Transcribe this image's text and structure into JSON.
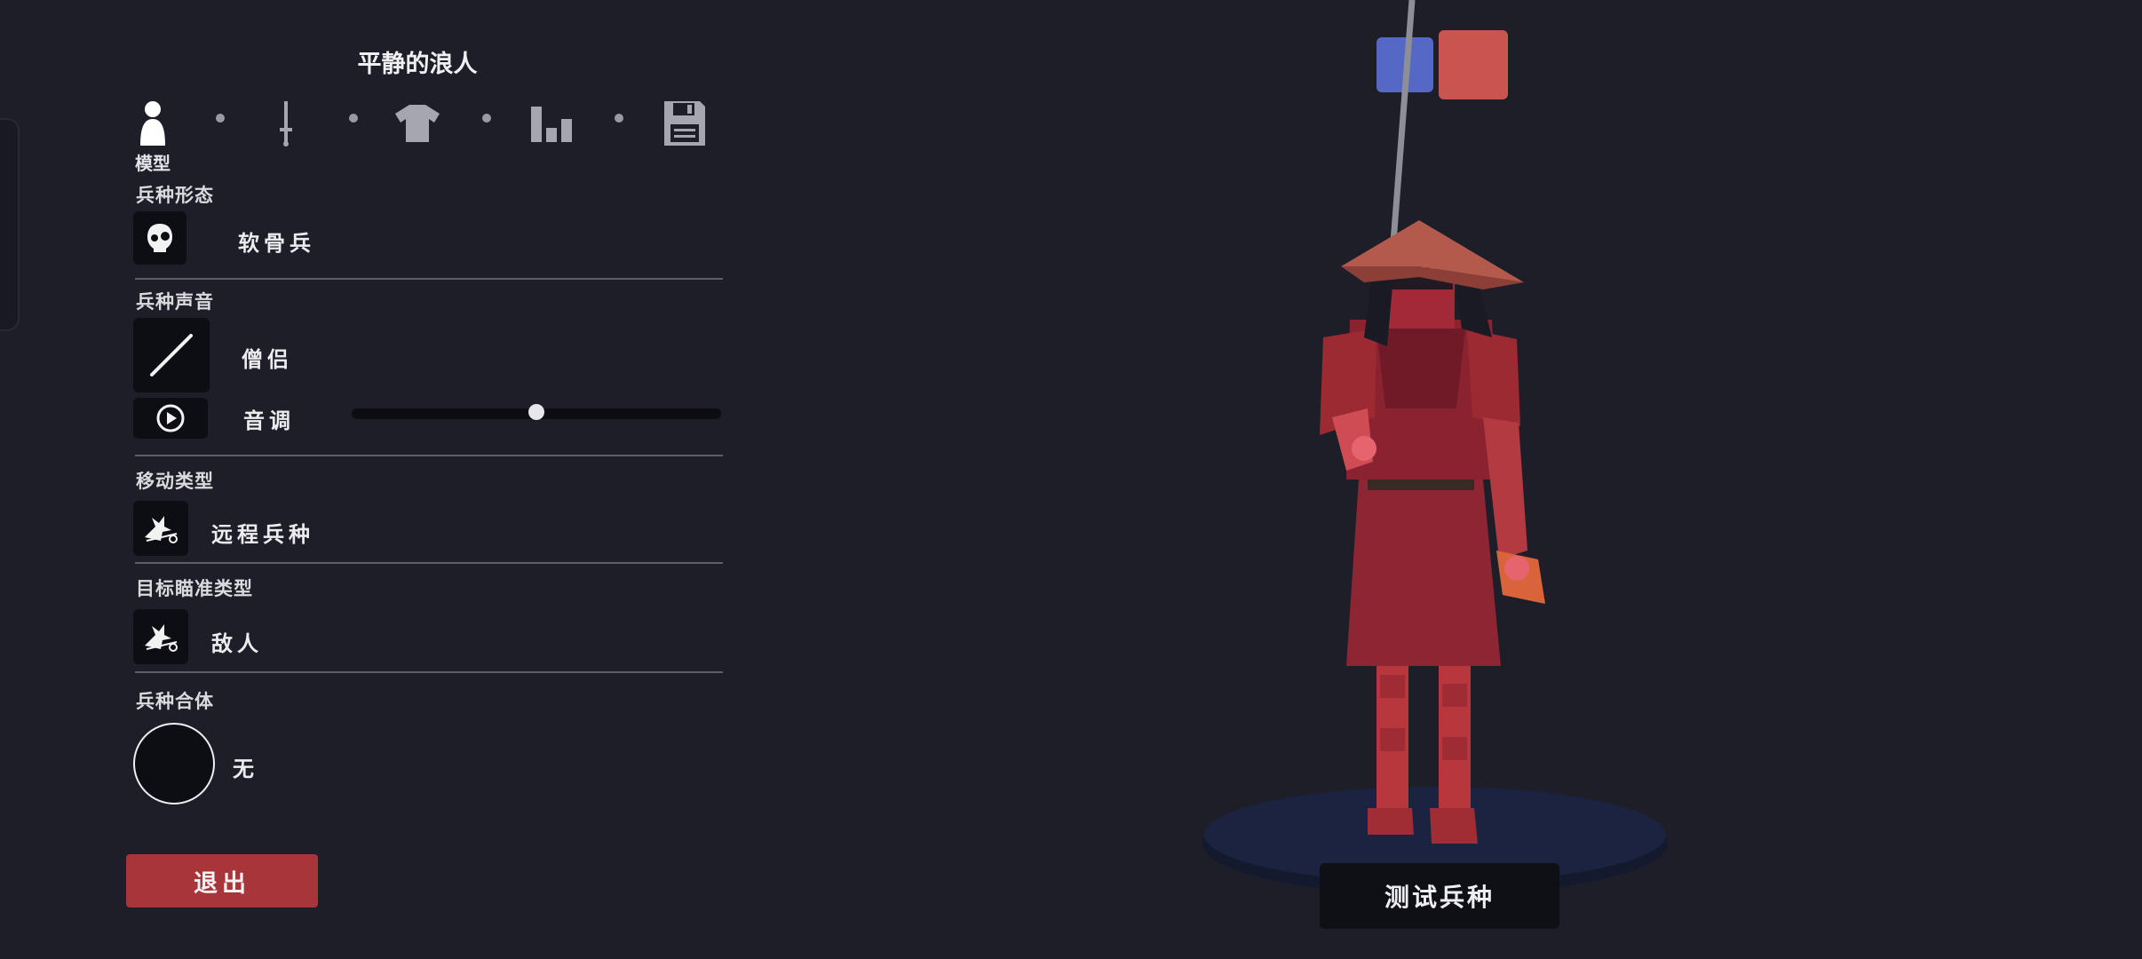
{
  "unit_title": "平静的浪人",
  "tabs": [
    {
      "icon": "person-icon",
      "active": true
    },
    {
      "icon": "sword-icon",
      "active": false
    },
    {
      "icon": "shirt-icon",
      "active": false
    },
    {
      "icon": "stats-icon",
      "active": false
    },
    {
      "icon": "save-icon",
      "active": false
    }
  ],
  "active_tab_label": "模型",
  "sections": {
    "form": {
      "heading": "兵种形态",
      "value": "软骨兵",
      "icon": "skull-icon"
    },
    "voice": {
      "heading": "兵种声音",
      "value": "僧侣",
      "icon": "staff-icon",
      "pitch_label": "音调",
      "pitch_level": 0.5,
      "play_icon": "play-icon"
    },
    "movement": {
      "heading": "移动类型",
      "value": "远程兵种",
      "icon": "movement-icon"
    },
    "targeting": {
      "heading": "目标瞄准类型",
      "value": "敌人",
      "icon": "target-icon"
    },
    "combine": {
      "heading": "兵种合体",
      "value": "无"
    }
  },
  "exit_label": "退出",
  "test_unit_label": "测试兵种",
  "colors": {
    "team_blue": "#5468c4",
    "team_red": "#c9554f",
    "exit": "#a8353a",
    "background": "#1e1e29"
  }
}
